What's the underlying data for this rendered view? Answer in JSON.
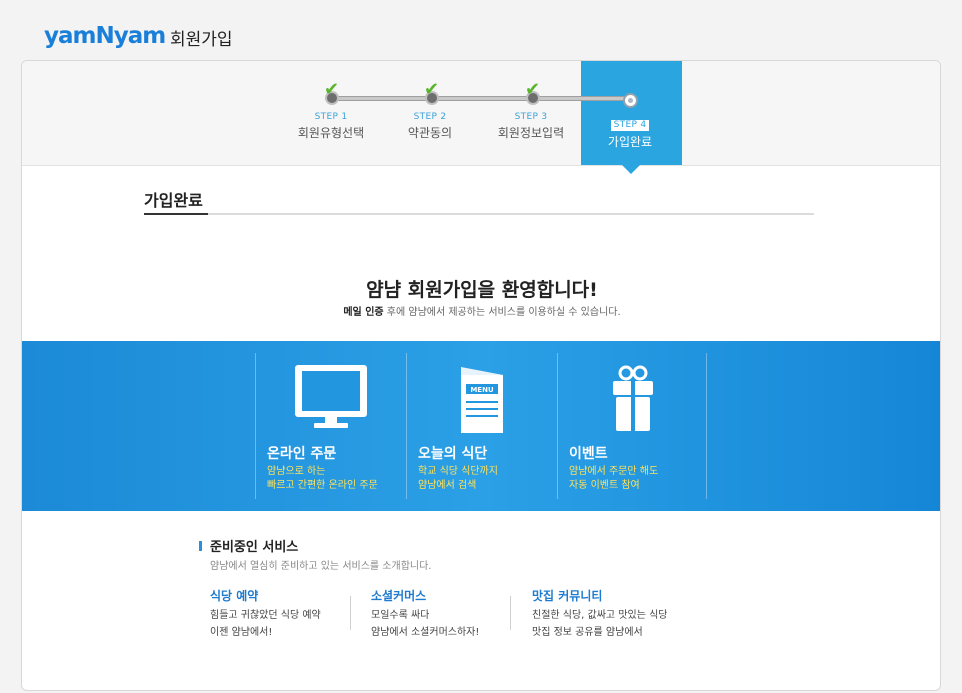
{
  "header": {
    "logo_text": "yamNyam",
    "page_title": "회원가입"
  },
  "steps": [
    {
      "num": "STEP 1",
      "name": "회원유형선택",
      "done": true
    },
    {
      "num": "STEP 2",
      "name": "약관동의",
      "done": true
    },
    {
      "num": "STEP 3",
      "name": "회원정보입력",
      "done": true
    },
    {
      "num": "STEP 4",
      "name": "가입완료",
      "done": false,
      "active": true
    }
  ],
  "section": {
    "title": "가입완료"
  },
  "welcome": {
    "headline": "얌냠 회원가입을 환영합니다!",
    "sub_bold": "메일 인증",
    "sub_rest": " 후에  얌냠에서 제공하는 서비스를 이용하실 수 있습니다."
  },
  "features": [
    {
      "icon": "monitor-icon",
      "title": "온라인 주문",
      "desc1": "얌냠으로 하는",
      "desc2": "빠르고 간편한 온라인 주문"
    },
    {
      "icon": "menu-icon",
      "icon_label": "MENU",
      "title": "오늘의 식단",
      "desc1": "학교 식당 식단까지",
      "desc2": "얌냠에서 검색"
    },
    {
      "icon": "gift-icon",
      "title": "이벤트",
      "desc1": "얌냠에서 주문만 해도",
      "desc2": "자동 이벤트 참여"
    }
  ],
  "upcoming": {
    "title": "준비중인 서비스",
    "subtitle": "얌냠에서 열심히 준비하고 있는 서비스를 소개합니다.",
    "services": [
      {
        "title": "식당 예약",
        "desc1": "힘들고 귀찮았던 식당 예약",
        "desc2": "이젠 얌냠에서!"
      },
      {
        "title": "소셜커머스",
        "desc1": "모일수록 싸다",
        "desc2": "얌냠에서 소셜커머스하자!"
      },
      {
        "title": "맛집 커뮤니티",
        "desc1": "친절한 식당, 값싸고 맛있는 식당",
        "desc2": "맛집 정보 공유를 얌냠에서"
      }
    ]
  },
  "colors": {
    "brand_blue": "#1a7fd9",
    "active_step": "#2aa5e0",
    "check_green": "#59b52e",
    "feature_desc_yellow": "#ffe25a"
  }
}
